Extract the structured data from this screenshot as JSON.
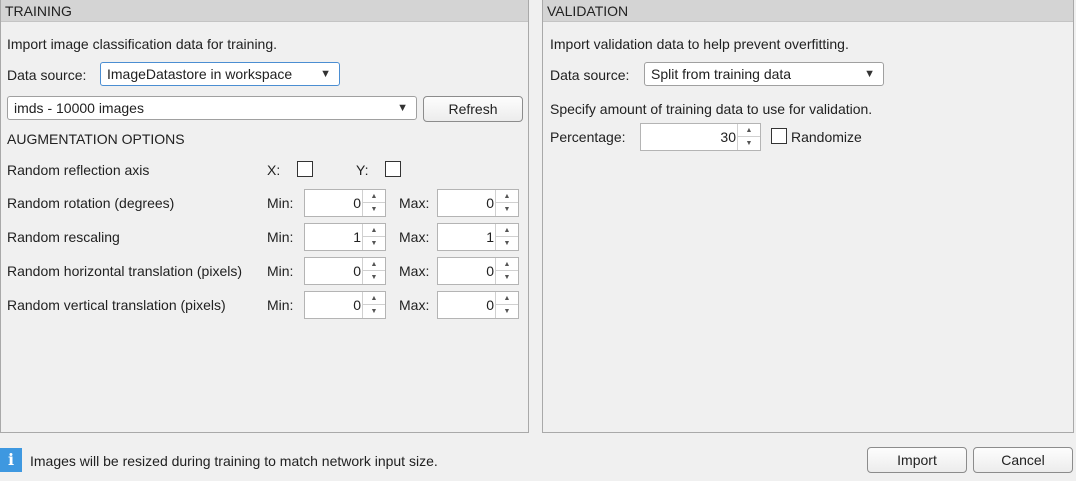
{
  "training": {
    "header": "TRAINING",
    "intro": "Import image classification data for training.",
    "data_source_label": "Data source:",
    "data_source_value": "ImageDatastore in workspace",
    "datastore_value": "imds - 10000 images",
    "refresh_label": "Refresh",
    "augmentation_title": "AUGMENTATION OPTIONS",
    "reflection": {
      "label": "Random reflection axis",
      "x_label": "X:",
      "y_label": "Y:",
      "x_checked": false,
      "y_checked": false
    },
    "rows": [
      {
        "label": "Random rotation (degrees)",
        "min_label": "Min:",
        "min": "0",
        "max_label": "Max:",
        "max": "0"
      },
      {
        "label": "Random rescaling",
        "min_label": "Min:",
        "min": "1",
        "max_label": "Max:",
        "max": "1"
      },
      {
        "label": "Random horizontal translation (pixels)",
        "min_label": "Min:",
        "min": "0",
        "max_label": "Max:",
        "max": "0"
      },
      {
        "label": "Random vertical translation (pixels)",
        "min_label": "Min:",
        "min": "0",
        "max_label": "Max:",
        "max": "0"
      }
    ]
  },
  "validation": {
    "header": "VALIDATION",
    "intro": "Import validation data to help prevent overfitting.",
    "data_source_label": "Data source:",
    "data_source_value": "Split from training data",
    "specify_text": "Specify amount of training data to use for validation.",
    "percentage_label": "Percentage:",
    "percentage_value": "30",
    "randomize_label": "Randomize",
    "randomize_checked": false
  },
  "footer": {
    "info_icon": "info-icon",
    "info_text": "Images will be resized during training to match network input size.",
    "import_label": "Import",
    "cancel_label": "Cancel"
  },
  "colors": {
    "header_bg": "#d4d4d4",
    "focus_border": "#4b8ed2",
    "info_icon": "#3e98e0"
  }
}
